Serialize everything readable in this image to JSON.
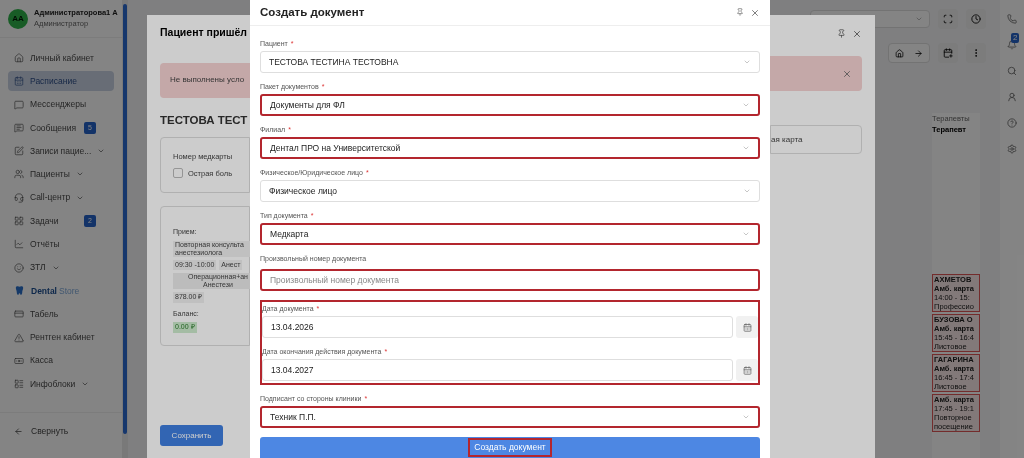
{
  "sidebar": {
    "avatar": "AA",
    "user_name": "Администраторова1 А",
    "user_role": "Администратор",
    "items": [
      {
        "kind": "link",
        "label": "Личный кабинет",
        "selected": false
      },
      {
        "kind": "link",
        "label": "Расписание",
        "selected": true
      },
      {
        "kind": "link",
        "label": "Мессенджеры",
        "selected": false
      },
      {
        "kind": "link",
        "label": "Сообщения",
        "selected": false,
        "badge": "5"
      },
      {
        "kind": "group",
        "label": "Записи пацие...",
        "selected": false
      },
      {
        "kind": "group",
        "label": "Пациенты",
        "selected": false
      },
      {
        "kind": "group",
        "label": "Call-центр",
        "selected": false
      },
      {
        "kind": "link",
        "label": "Задачи",
        "selected": false,
        "badge": "2"
      },
      {
        "kind": "link",
        "label": "Отчёты",
        "selected": false
      },
      {
        "kind": "group",
        "label": "ЗТЛ",
        "selected": false
      },
      {
        "kind": "brand",
        "label": "Dental",
        "suffix": "Store",
        "selected": false
      },
      {
        "kind": "link",
        "label": "Табель",
        "selected": false
      },
      {
        "kind": "link",
        "label": "Рентген кабинет",
        "selected": false
      },
      {
        "kind": "link",
        "label": "Касса",
        "selected": false
      },
      {
        "kind": "group",
        "label": "Инфоблоки",
        "selected": false
      }
    ],
    "collapse": "Свернуть"
  },
  "rail": {
    "notifications_badge": "2"
  },
  "schedule": {
    "group": "Терапевты",
    "column": "Терапевт",
    "appointments": [
      {
        "name": "АХМЕТОВ",
        "card": "Амб. карта",
        "time": "14:00 - 15:",
        "note": "Профессио"
      },
      {
        "name": "БУЗОВА О",
        "card": "Амб. карта",
        "time": "15:45 - 16:4",
        "note": "Листовое"
      },
      {
        "name": "ГАГАРИНА",
        "card": "Амб. карта",
        "time": "16:45 - 17:4",
        "note": "Листовое"
      },
      {
        "card": "Амб. карта",
        "time": "17:45 - 19:1",
        "note": "Повторное посещение"
      }
    ]
  },
  "patient_dialog": {
    "title": "Пациент пришёл",
    "alert": "Не выполнены усло",
    "patient": "ТЕСТОВА ТЕСТ",
    "card_number_label": "Номер медкарты",
    "acute_pain": {
      "label": "Острая боль",
      "checked": false
    },
    "visit_label": "Прием:",
    "service": "Повторная консульта анестезиолога",
    "time": "09:30 -10:00",
    "doctor": "Анест",
    "room": "Операционная+ан Анестези",
    "price": "878.00 ₽",
    "balance_label": "Баланс:",
    "balance": "0.00 ₽",
    "side_text": "ая карта",
    "save": "Сохранить"
  },
  "modal": {
    "title": "Создать документ",
    "fields": [
      {
        "kind": "select",
        "label": "Пациент",
        "required_mark": "*",
        "value": "ТЕСТОВА ТЕСТИНА ТЕСТОВНА",
        "highlighted": false
      },
      {
        "kind": "select",
        "label": "Пакет документов",
        "required_mark": "*",
        "value": "Документы для ФЛ",
        "highlighted": true
      },
      {
        "kind": "select",
        "label": "Филиал",
        "required_mark": "*",
        "value": "Дентал ПРО на Университетской",
        "highlighted": true
      },
      {
        "kind": "select",
        "label": "Физическое/Юридическое лицо",
        "required_mark": "*",
        "value": "Физическое лицо",
        "highlighted": false
      },
      {
        "kind": "select",
        "label": "Тип документа",
        "required_mark": "*",
        "value": "Медкарта",
        "highlighted": true
      },
      {
        "kind": "input",
        "label": "Произвольный номер документа",
        "placeholder": "Произвольный номер документа",
        "highlighted": true
      },
      {
        "kind": "dates",
        "highlighted": true,
        "items": [
          {
            "label": "Дата документа",
            "required_mark": "*",
            "value": "13.04.2026"
          },
          {
            "label": "Дата окончания действия документа",
            "required_mark": "*",
            "value": "13.04.2027"
          }
        ]
      },
      {
        "kind": "select",
        "label": "Подписант со стороны клиники",
        "required_mark": "*",
        "value": "Техник П.П.",
        "highlighted": true
      }
    ],
    "submit": {
      "label": "Создать документ",
      "highlighted": true
    }
  }
}
